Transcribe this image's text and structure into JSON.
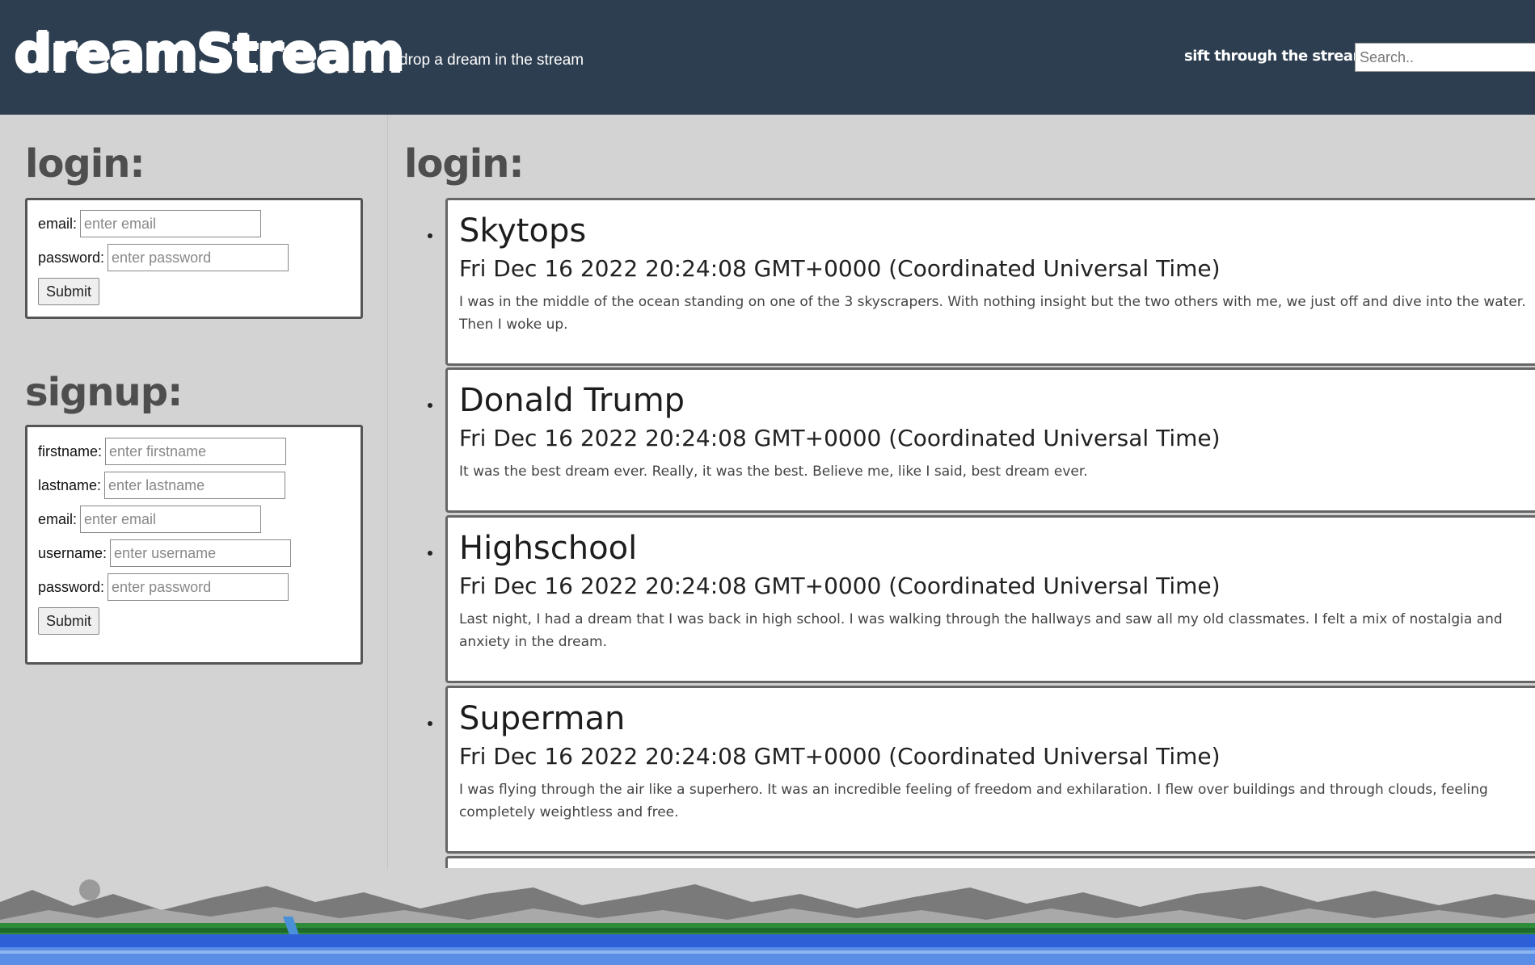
{
  "header": {
    "logo": "dreamStream",
    "tagline": "drop a dream in the stream",
    "search_label": "sift through the stream:",
    "search_placeholder": "Search.."
  },
  "login": {
    "title": "login:",
    "email_label": "email:",
    "email_placeholder": "enter email",
    "password_label": "password:",
    "password_placeholder": "enter password",
    "submit_label": "Submit"
  },
  "signup": {
    "title": "signup:",
    "firstname_label": "firstname:",
    "firstname_placeholder": "enter firstname",
    "lastname_label": "lastname:",
    "lastname_placeholder": "enter lastname",
    "email_label": "email:",
    "email_placeholder": "enter email",
    "username_label": "username:",
    "username_placeholder": "enter username",
    "password_label": "password:",
    "password_placeholder": "enter password",
    "submit_label": "Submit"
  },
  "feed": {
    "title": "login:",
    "dreams": [
      {
        "title": "Skytops",
        "date": "Fri Dec 16 2022 20:24:08 GMT+0000 (Coordinated Universal Time)",
        "body": "I was in the middle of the ocean standing on one of the 3 skyscrapers. With nothing insight but the two others with me, we just off and dive into the water. Then I woke up."
      },
      {
        "title": "Donald Trump",
        "date": "Fri Dec 16 2022 20:24:08 GMT+0000 (Coordinated Universal Time)",
        "body": "It was the best dream ever. Really, it was the best. Believe me, like I said, best dream ever."
      },
      {
        "title": "Highschool",
        "date": "Fri Dec 16 2022 20:24:08 GMT+0000 (Coordinated Universal Time)",
        "body": "Last night, I had a dream that I was back in high school. I was walking through the hallways and saw all my old classmates. I felt a mix of nostalgia and anxiety in the dream."
      },
      {
        "title": "Superman",
        "date": "Fri Dec 16 2022 20:24:08 GMT+0000 (Coordinated Universal Time)",
        "body": "I was flying through the air like a superhero. It was an incredible feeling of freedom and exhilaration. I flew over buildings and through clouds, feeling completely weightless and free."
      }
    ]
  },
  "colors": {
    "header_bg": "#2d3e50",
    "page_bg": "#d3d3d3",
    "title_gray": "#4e4e4e"
  }
}
